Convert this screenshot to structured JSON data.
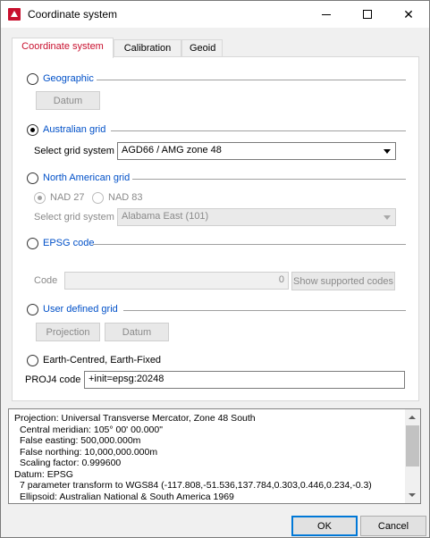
{
  "window": {
    "title": "Coordinate system"
  },
  "tabs": [
    {
      "label": "Coordinate system",
      "active": true
    },
    {
      "label": "Calibration",
      "active": false
    },
    {
      "label": "Geoid",
      "active": false
    }
  ],
  "geographic": {
    "label": "Geographic",
    "selected": false,
    "datum_button": "Datum"
  },
  "australian": {
    "label": "Australian grid",
    "selected": true,
    "select_label": "Select grid system",
    "grid_value": "AGD66 / AMG zone 48"
  },
  "north_american": {
    "label": "North American grid",
    "selected": false,
    "nad27_label": "NAD 27",
    "nad83_label": "NAD 83",
    "select_label": "Select grid system",
    "grid_value": "Alabama East (101)"
  },
  "epsg": {
    "label": "EPSG code",
    "selected": false,
    "code_label": "Code",
    "code_value": "0",
    "supported_button": "Show supported codes"
  },
  "user_defined": {
    "label": "User defined grid",
    "selected": false,
    "projection_button": "Projection",
    "datum_button": "Datum"
  },
  "ecef": {
    "label": "Earth-Centred, Earth-Fixed",
    "selected": false
  },
  "proj4": {
    "label": "PROJ4 code",
    "value": "+init=epsg:20248"
  },
  "info_lines": [
    {
      "text": "Projection: Universal Transverse Mercator, Zone 48 South",
      "indent": false
    },
    {
      "text": "Central meridian: 105° 00' 00.000\"",
      "indent": true
    },
    {
      "text": "False easting: 500,000.000m",
      "indent": true
    },
    {
      "text": "False northing: 10,000,000.000m",
      "indent": true
    },
    {
      "text": "Scaling factor: 0.999600",
      "indent": true
    },
    {
      "text": "Datum: EPSG",
      "indent": false
    },
    {
      "text": "7 parameter transform to WGS84 (-117.808,-51.536,137.784,0.303,0.446,0.234,-0.3)",
      "indent": true
    },
    {
      "text": "Ellipsoid: Australian National & South America 1969",
      "indent": true
    }
  ],
  "footer": {
    "ok_label": "OK",
    "cancel_label": "Cancel"
  }
}
